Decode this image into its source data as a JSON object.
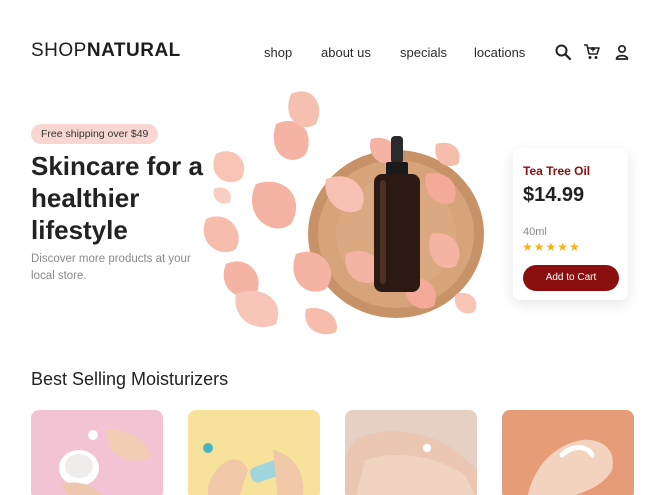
{
  "brand": {
    "logo_light": "SHOP",
    "logo_bold": "NATURAL"
  },
  "nav": {
    "links": [
      "shop",
      "about us",
      "specials",
      "locations"
    ],
    "icons": [
      "search-icon",
      "cart-icon",
      "user-icon"
    ]
  },
  "hero": {
    "badge": "Free shipping over $49",
    "title": "Skincare for a healthier lifestyle",
    "subtitle": "Discover more products at your local store."
  },
  "product_card": {
    "name": "Tea Tree Oil",
    "price": "$14.99",
    "size": "40ml",
    "rating": 5,
    "stars": "★★★★★",
    "button": "Add to Cart"
  },
  "section": {
    "title": "Best Selling Moisturizers"
  },
  "colors": {
    "accent_red": "#8c0f0f",
    "badge_pink": "#f8d7d3",
    "star_yellow": "#f3b31d",
    "tile_pink": "#f2c3d2",
    "tile_yellow": "#f7e29b",
    "tile_beige": "#e6cfc3",
    "tile_orange": "#e79c78"
  }
}
